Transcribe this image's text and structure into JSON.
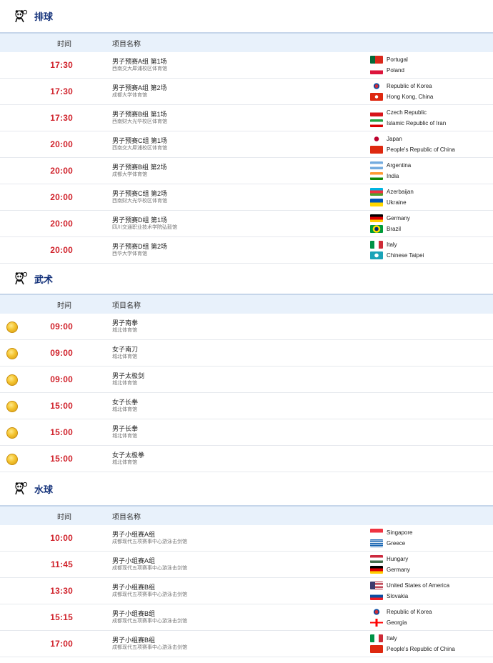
{
  "sections": [
    {
      "title": "排球",
      "icon": "volleyball-panda-icon",
      "header": {
        "time": "时间",
        "name": "项目名称"
      },
      "rows": [
        {
          "time": "17:30",
          "name": "男子预赛A组 第1场",
          "venue": "西南交大犀浦校区体育馆",
          "teams": [
            {
              "name": "Portugal",
              "flag": "portugal"
            },
            {
              "name": "Poland",
              "flag": "poland"
            }
          ]
        },
        {
          "time": "17:30",
          "name": "男子预赛A组 第2场",
          "venue": "成都大学体育馆",
          "teams": [
            {
              "name": "Republic of Korea",
              "flag": "korea"
            },
            {
              "name": "Hong Kong, China",
              "flag": "hongkong"
            }
          ]
        },
        {
          "time": "17:30",
          "name": "男子预赛B组 第1场",
          "venue": "西南财大光华校区体育馆",
          "teams": [
            {
              "name": "Czech Republic",
              "flag": "czech"
            },
            {
              "name": "Islamic Republic of Iran",
              "flag": "iran"
            }
          ]
        },
        {
          "time": "20:00",
          "name": "男子预赛C组 第1场",
          "venue": "西南交大犀浦校区体育馆",
          "teams": [
            {
              "name": "Japan",
              "flag": "japan"
            },
            {
              "name": "People's Republic of China",
              "flag": "china"
            }
          ]
        },
        {
          "time": "20:00",
          "name": "男子预赛B组 第2场",
          "venue": "成都大学体育馆",
          "teams": [
            {
              "name": "Argentina",
              "flag": "argentina"
            },
            {
              "name": "India",
              "flag": "india"
            }
          ]
        },
        {
          "time": "20:00",
          "name": "男子预赛C组 第2场",
          "venue": "西南财大光华校区体育馆",
          "teams": [
            {
              "name": "Azerbaijan",
              "flag": "azerbaijan"
            },
            {
              "name": "Ukraine",
              "flag": "ukraine"
            }
          ]
        },
        {
          "time": "20:00",
          "name": "男子预赛D组 第1场",
          "venue": "四川交通职业技术学院弘毅馆",
          "teams": [
            {
              "name": "Germany",
              "flag": "germany"
            },
            {
              "name": "Brazil",
              "flag": "brazil"
            }
          ]
        },
        {
          "time": "20:00",
          "name": "男子预赛D组 第2场",
          "venue": "西华大学体育馆",
          "teams": [
            {
              "name": "Italy",
              "flag": "italy"
            },
            {
              "name": "Chinese Taipei",
              "flag": "taipei"
            }
          ]
        }
      ]
    },
    {
      "title": "武术",
      "icon": "wushu-panda-icon",
      "header": {
        "time": "时间",
        "name": "项目名称"
      },
      "rows": [
        {
          "time": "09:00",
          "name": "男子南拳",
          "venue": "城北体育馆",
          "medal": true
        },
        {
          "time": "09:00",
          "name": "女子南刀",
          "venue": "城北体育馆",
          "medal": true
        },
        {
          "time": "09:00",
          "name": "男子太极剑",
          "venue": "城北体育馆",
          "medal": true
        },
        {
          "time": "15:00",
          "name": "女子长拳",
          "venue": "城北体育馆",
          "medal": true
        },
        {
          "time": "15:00",
          "name": "男子长拳",
          "venue": "城北体育馆",
          "medal": true
        },
        {
          "time": "15:00",
          "name": "女子太极拳",
          "venue": "城北体育馆",
          "medal": true
        }
      ]
    },
    {
      "title": "水球",
      "icon": "waterpolo-panda-icon",
      "header": {
        "time": "时间",
        "name": "项目名称"
      },
      "rows": [
        {
          "time": "10:00",
          "name": "男子小组赛A组",
          "venue": "成都现代五项赛事中心游泳击剑馆",
          "teams": [
            {
              "name": "Singapore",
              "flag": "singapore"
            },
            {
              "name": "Greece",
              "flag": "greece"
            }
          ]
        },
        {
          "time": "11:45",
          "name": "男子小组赛A组",
          "venue": "成都现代五项赛事中心游泳击剑馆",
          "teams": [
            {
              "name": "Hungary",
              "flag": "hungary"
            },
            {
              "name": "Germany",
              "flag": "germany"
            }
          ]
        },
        {
          "time": "13:30",
          "name": "男子小组赛B组",
          "venue": "成都现代五项赛事中心游泳击剑馆",
          "teams": [
            {
              "name": "United States of America",
              "flag": "usa"
            },
            {
              "name": "Slovakia",
              "flag": "slovakia"
            }
          ]
        },
        {
          "time": "15:15",
          "name": "男子小组赛B组",
          "venue": "成都现代五项赛事中心游泳击剑馆",
          "teams": [
            {
              "name": "Republic of Korea",
              "flag": "korea"
            },
            {
              "name": "Georgia",
              "flag": "georgia"
            }
          ]
        },
        {
          "time": "17:00",
          "name": "男子小组赛B组",
          "venue": "成都现代五项赛事中心游泳击剑馆",
          "teams": [
            {
              "name": "Italy",
              "flag": "italy"
            },
            {
              "name": "People's Republic of China",
              "flag": "china"
            }
          ]
        }
      ]
    }
  ],
  "colors": {
    "time_red": "#d0222b",
    "title_blue": "#13317a",
    "header_bg": "#e8f1fb",
    "medal_gold": "#f4c430"
  }
}
